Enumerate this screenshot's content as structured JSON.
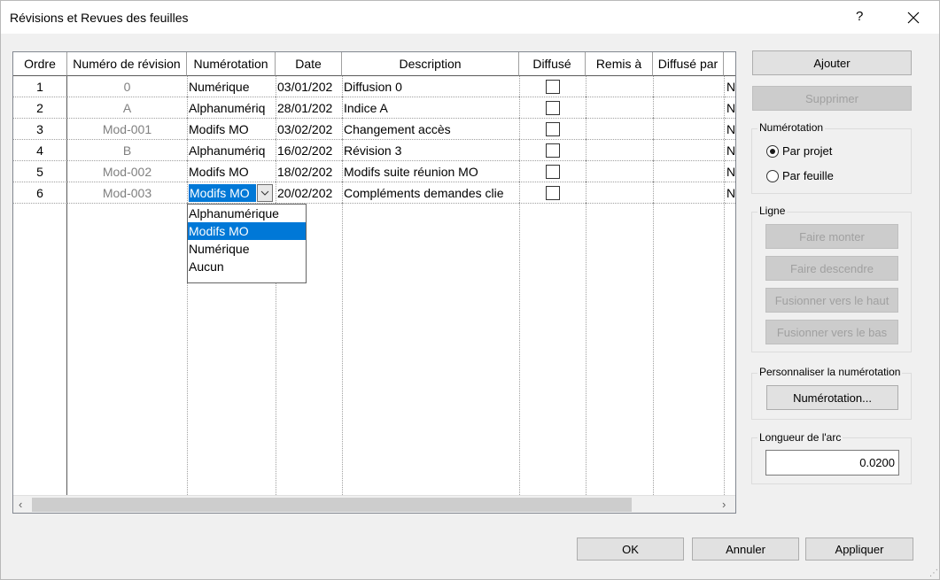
{
  "window": {
    "title": "Révisions et Revues des feuilles",
    "help_label": "?"
  },
  "grid": {
    "headers": [
      "Ordre",
      "Numéro de révision",
      "Numérotation",
      "Date",
      "Description",
      "Diffusé",
      "Remis à",
      "Diffusé par"
    ],
    "rows": [
      {
        "ordre": "1",
        "numero": "0",
        "numerotation": "Numérique",
        "date": "03/01/202",
        "description": "Diffusion 0",
        "diffuse": false,
        "overflow": "N"
      },
      {
        "ordre": "2",
        "numero": "A",
        "numerotation": "Alphanumériq",
        "date": "28/01/202",
        "description": "Indice A",
        "diffuse": false,
        "overflow": "N"
      },
      {
        "ordre": "3",
        "numero": "Mod-001",
        "numerotation": "Modifs MO",
        "date": "03/02/202",
        "description": "Changement accès",
        "diffuse": false,
        "overflow": "N"
      },
      {
        "ordre": "4",
        "numero": "B",
        "numerotation": "Alphanumériq",
        "date": "16/02/202",
        "description": "Révision 3",
        "diffuse": false,
        "overflow": "N"
      },
      {
        "ordre": "5",
        "numero": "Mod-002",
        "numerotation": "Modifs MO",
        "date": "18/02/202",
        "description": "Modifs suite réunion MO",
        "diffuse": false,
        "overflow": "N"
      },
      {
        "ordre": "6",
        "numero": "Mod-003",
        "numerotation": "Modifs MO",
        "date": "20/02/202",
        "description": "Compléments demandes clie",
        "diffuse": false,
        "overflow": "N"
      }
    ],
    "dropdown": {
      "options": [
        "Alphanumérique",
        "Modifs MO",
        "Numérique",
        "Aucun"
      ],
      "selected_index": 1
    }
  },
  "buttons": {
    "ajouter": "Ajouter",
    "supprimer": "Supprimer",
    "faire_monter": "Faire monter",
    "faire_descendre": "Faire descendre",
    "fusionner_haut": "Fusionner vers le haut",
    "fusionner_bas": "Fusionner vers le bas",
    "numerotation": "Numérotation...",
    "ok": "OK",
    "annuler": "Annuler",
    "appliquer": "Appliquer"
  },
  "groups": {
    "numerotation": {
      "label": "Numérotation",
      "par_projet": "Par projet",
      "par_feuille": "Par feuille",
      "selected": "par_projet"
    },
    "ligne": {
      "label": "Ligne"
    },
    "personnaliser": {
      "label": "Personnaliser la numérotation"
    },
    "longueur": {
      "label": "Longueur de l'arc",
      "value": "0.0200"
    }
  },
  "colors": {
    "selection": "#0078d7",
    "disabled_text": "#a0a0a0"
  }
}
